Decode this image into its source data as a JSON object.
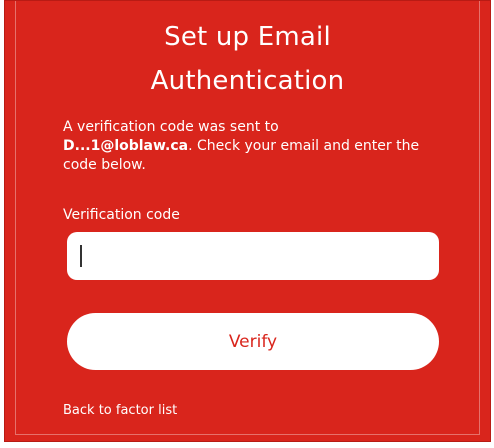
{
  "title_line1": "Set up Email",
  "title_line2": "Authentication",
  "message": {
    "intro": "A verification code was sent to",
    "email": "D...1@loblaw.ca",
    "rest": ". Check your email and enter the code below."
  },
  "code_field": {
    "label": "Verification code",
    "value": "",
    "placeholder": ""
  },
  "verify_button": {
    "label": "Verify"
  },
  "back_link": {
    "label": "Back to factor list"
  },
  "colors": {
    "panel_background": "#d9251c",
    "button_text": "#d9251c",
    "text": "#ffffff"
  }
}
